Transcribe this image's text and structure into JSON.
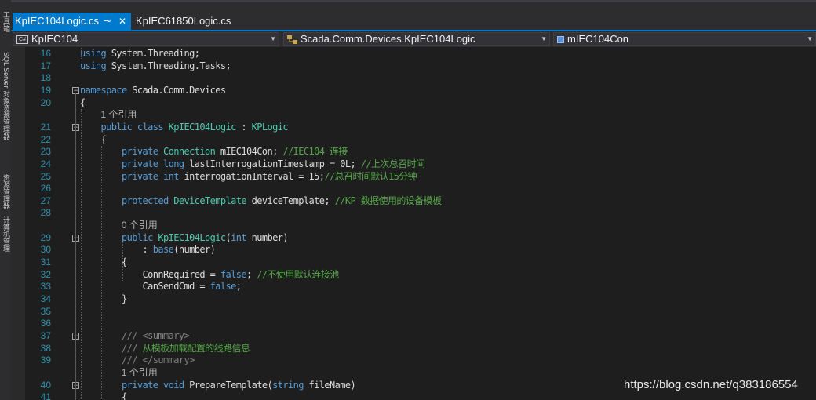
{
  "side_panel": {
    "labels": [
      "工具箱",
      "SQL Server 对象资源管理器",
      "资源管理器",
      "计算机管理"
    ]
  },
  "tabs": [
    {
      "label": "KpIEC104Logic.cs",
      "active": true,
      "pin": "⊸",
      "close": "✕"
    },
    {
      "label": "KpIEC61850Logic.cs",
      "active": false
    }
  ],
  "navigation": {
    "project": {
      "label": "KpIEC104",
      "icon": "C#"
    },
    "type": {
      "label": "Scada.Comm.Devices.KpIEC104Logic",
      "icon": "class-icon"
    },
    "member": {
      "label": "mIEC104Con",
      "icon": "field-icon"
    }
  },
  "code_lines": [
    {
      "num": "16",
      "html": "<span class=\"k\">using</span> System.Threading;"
    },
    {
      "num": "17",
      "html": "<span class=\"k\">using</span> System.Threading.Tasks;"
    },
    {
      "num": "18",
      "html": ""
    },
    {
      "num": "19",
      "html": "<span class=\"k\">namespace</span> Scada.Comm.Devices",
      "fold": "−"
    },
    {
      "num": "20",
      "html": "{"
    },
    {
      "num": "",
      "lens": "1 个引用"
    },
    {
      "num": "21",
      "html": "    <span class=\"k\">public</span> <span class=\"k\">class</span> <span class=\"t\">KpIEC104Logic</span> : <span class=\"t\">KPLogic</span>",
      "fold": "−"
    },
    {
      "num": "22",
      "html": "    {"
    },
    {
      "num": "23",
      "html": "        <span class=\"k\">private</span> <span class=\"t\">Connection</span> mIEC104Con; <span class=\"c\">//IEC104 连接</span>"
    },
    {
      "num": "24",
      "html": "        <span class=\"k\">private</span> <span class=\"k\">long</span> lastInterrogationTimestamp = 0L; <span class=\"c\">//上次总召时间</span>"
    },
    {
      "num": "25",
      "html": "        <span class=\"k\">private</span> <span class=\"k\">int</span> interrogationInterval = 15;<span class=\"c\">//总召时间默认15分钟</span>"
    },
    {
      "num": "26",
      "html": ""
    },
    {
      "num": "27",
      "html": "        <span class=\"k\">protected</span> <span class=\"t\">DeviceTemplate</span> deviceTemplate; <span class=\"c\">//KP 数据使用的设备模板</span>"
    },
    {
      "num": "28",
      "html": ""
    },
    {
      "num": "",
      "lens": "0 个引用"
    },
    {
      "num": "29",
      "html": "        <span class=\"k\">public</span> <span class=\"t\">KpIEC104Logic</span>(<span class=\"k\">int</span> number)",
      "fold": "−"
    },
    {
      "num": "30",
      "html": "            : <span class=\"k\">base</span>(number)"
    },
    {
      "num": "31",
      "html": "        {"
    },
    {
      "num": "32",
      "html": "            ConnRequired = <span class=\"k\">false</span>; <span class=\"c\">//不使用默认连接池</span>"
    },
    {
      "num": "33",
      "html": "            CanSendCmd = <span class=\"k\">false</span>;"
    },
    {
      "num": "34",
      "html": "        }"
    },
    {
      "num": "35",
      "html": ""
    },
    {
      "num": "36",
      "html": ""
    },
    {
      "num": "37",
      "html": "        <span class=\"x\">///</span> <span class=\"x\">&lt;summary&gt;</span>",
      "fold": "−"
    },
    {
      "num": "38",
      "html": "        <span class=\"x\">///</span> <span class=\"c\">从模板加载配置的线路信息</span>"
    },
    {
      "num": "39",
      "html": "        <span class=\"x\">///</span> <span class=\"x\">&lt;/summary&gt;</span>"
    },
    {
      "num": "",
      "lens": "1 个引用"
    },
    {
      "num": "40",
      "html": "        <span class=\"k\">private</span> <span class=\"k\">void</span> PrepareTemplate(<span class=\"k\">string</span> fileName)",
      "fold": "−"
    },
    {
      "num": "41",
      "html": "        {"
    }
  ],
  "watermark": "https://blog.csdn.net/q383186554",
  "colors": {
    "accent": "#007acc",
    "keyword": "#569cd6",
    "type": "#4ec9b0",
    "comment": "#57a64a",
    "doc_tag": "#808080",
    "line_number": "#2b91af"
  }
}
